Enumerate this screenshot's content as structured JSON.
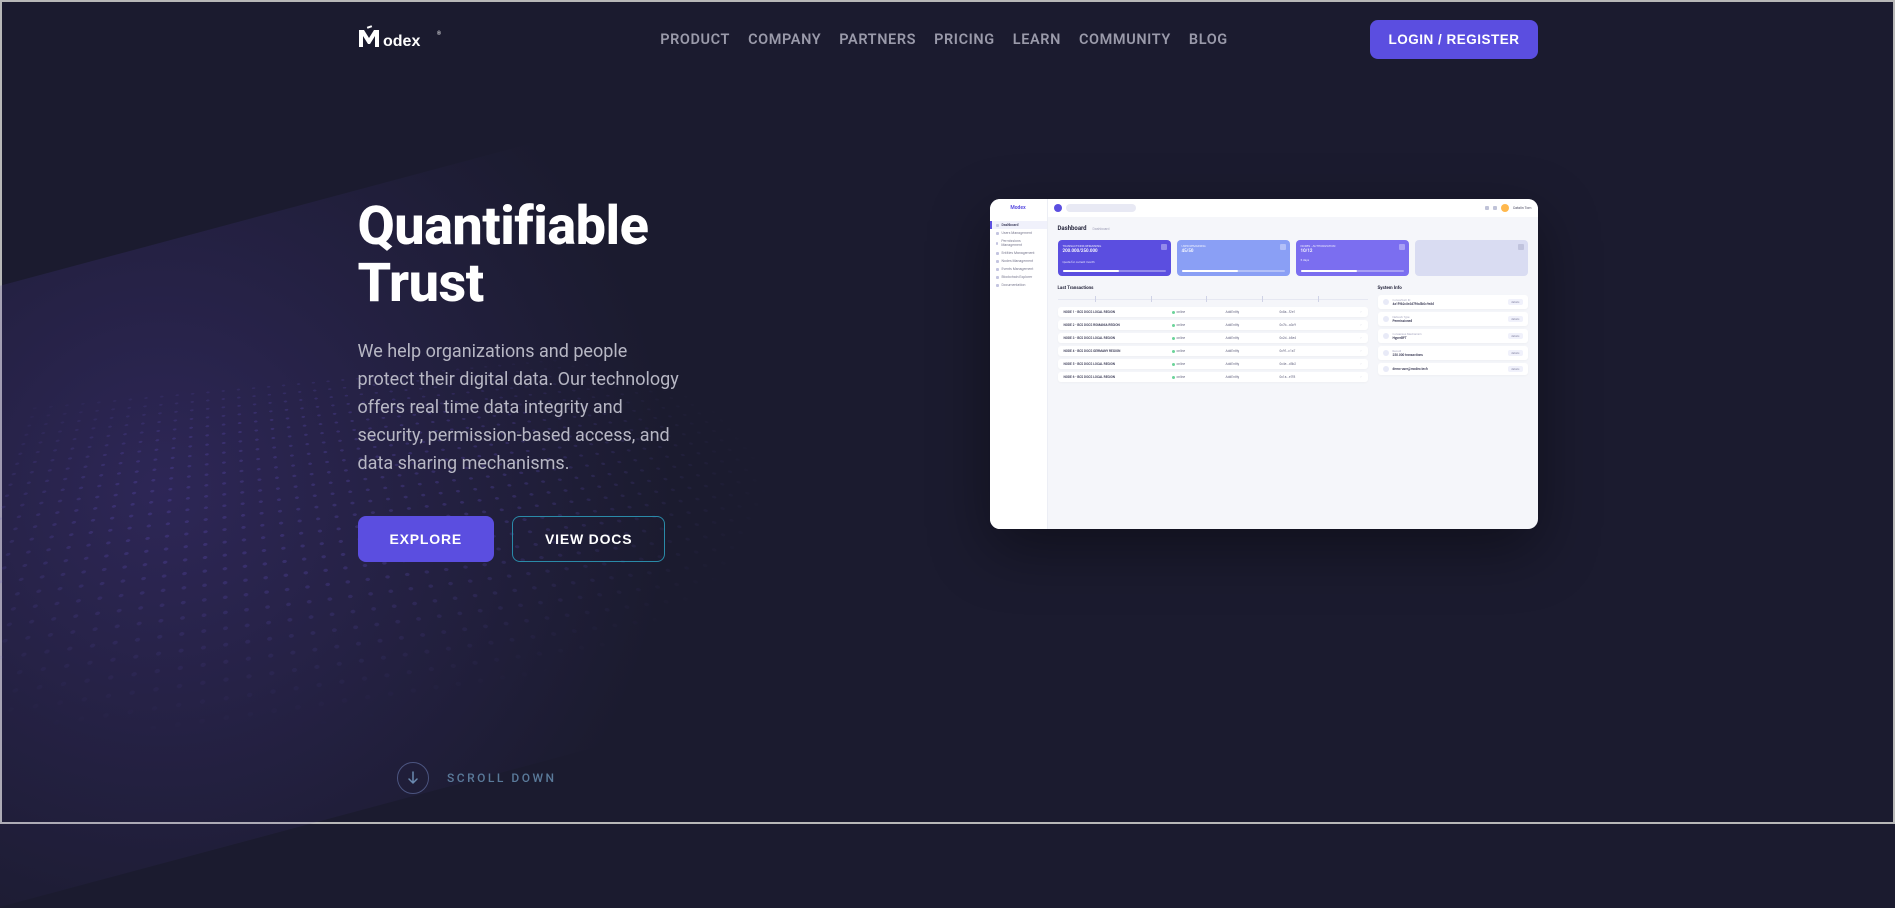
{
  "brand": "Modex",
  "nav": {
    "items": [
      "PRODUCT",
      "COMPANY",
      "PARTNERS",
      "PRICING",
      "LEARN",
      "COMMUNITY",
      "BLOG"
    ],
    "login": "LOGIN / REGISTER"
  },
  "hero": {
    "title_line1": "Quantifiable",
    "title_line2": "Trust",
    "description": "We help organizations and people protect their digital data. Our technology offers real time data integrity and security, permission-based access, and data sharing mechanisms.",
    "explore": "EXPLORE",
    "view_docs": "VIEW DOCS"
  },
  "scroll": "SCROLL DOWN",
  "preview": {
    "brand": "Modex",
    "user": "Catalin Tom",
    "menu": [
      "Dashboard",
      "Users Management",
      "Permissions Management",
      "Entities Management",
      "Nodes Management",
      "Events Management",
      "Blockchain Explorer",
      "Documentation"
    ],
    "header_title": "Dashboard",
    "header_sub": "Dashboard",
    "cards": [
      {
        "title": "TRANSACTIONS REMAINING",
        "value": "200.000/250.000",
        "sub": "Quota for current month"
      },
      {
        "title": "USER REMAINING",
        "value": "45/50"
      },
      {
        "title": "NODES - AUTHORIZATION",
        "value": "10/12",
        "sub": "5 days"
      },
      {
        "title": "",
        "value": ""
      }
    ],
    "trans_title": "Last Transactions",
    "trans_rows": [
      {
        "node": "NODE 1 - BCS DOCS LOCAL REGION",
        "status": "online",
        "kind": "AddEntity",
        "hash": "0x8a...f2e1"
      },
      {
        "node": "NODE 2 - BCS DOCS ROMANIA REGION",
        "status": "online",
        "kind": "AddEntity",
        "hash": "0x7b...a3c9"
      },
      {
        "node": "NODE 3 - BCS DOCS LOCAL REGION",
        "status": "online",
        "kind": "AddEntity",
        "hash": "0x2d...b8e4"
      },
      {
        "node": "NODE 4 - BCS DOCS GERMANY REGION",
        "status": "online",
        "kind": "AddEntity",
        "hash": "0x9f...c1a7"
      },
      {
        "node": "NODE 5 - BCS DOCS LOCAL REGION",
        "status": "online",
        "kind": "AddEntity",
        "hash": "0x4e...d5b2"
      },
      {
        "node": "NODE 6 - BCS DOCS LOCAL REGION",
        "status": "online",
        "kind": "AddEntity",
        "hash": "0x1a...e7f8"
      }
    ],
    "sys_title": "System Info",
    "sys_rows": [
      {
        "label": "Consortium ID",
        "value": "4a1f9b2c8e3d7f6a5b0c9e8d",
        "pill": "details"
      },
      {
        "label": "Network Type",
        "value": "Permissioned",
        "pill": "details"
      },
      {
        "label": "Consensus Mechanism",
        "value": "HyperBFT",
        "pill": "details"
      },
      {
        "label": "Record",
        "value": "250.000 transactions",
        "pill": "details"
      },
      {
        "label": "",
        "value": "demo-user@modex.tech",
        "pill": "details"
      }
    ]
  }
}
